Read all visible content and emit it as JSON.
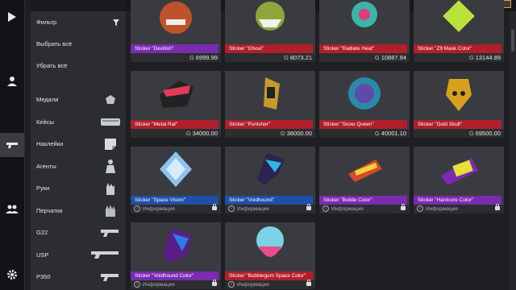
{
  "filter": {
    "title": "Фильтр",
    "select_all": "Выбрать всё",
    "deselect_all": "Убрать всё",
    "categories": [
      {
        "label": "Медали",
        "icon": "medal-icon"
      },
      {
        "label": "Кейсы",
        "icon": "case-icon"
      },
      {
        "label": "Наклейки",
        "icon": "sticker-icon"
      },
      {
        "label": "Агенты",
        "icon": "agent-icon"
      },
      {
        "label": "Руки",
        "icon": "hands-icon"
      },
      {
        "label": "Перчатки",
        "icon": "gloves-icon"
      },
      {
        "label": "G22",
        "icon": "pistol-icon"
      },
      {
        "label": "USP",
        "icon": "pistol-icon"
      },
      {
        "label": "P350",
        "icon": "pistol-icon"
      }
    ]
  },
  "currency_symbol": "G",
  "info_label": "Информация",
  "items": [
    {
      "name": "Sticker \"Devilish\"",
      "price": "6999.99",
      "rarity_color": "#7b2bb0"
    },
    {
      "name": "Sticker \"Ghoul\"",
      "price": "8073.21",
      "rarity_color": "#b01f2a"
    },
    {
      "name": "Sticker \"Radiate Heat\"",
      "price": "10887.94",
      "rarity_color": "#b01f2a"
    },
    {
      "name": "Sticker \"Z9 Mask Color\"",
      "price": "13144.89",
      "rarity_color": "#b01f2a"
    },
    {
      "name": "Sticker \"Metal Rat\"",
      "price": "34000.00",
      "rarity_color": "#b01f2a"
    },
    {
      "name": "Sticker \"Punisher\"",
      "price": "36000.00",
      "rarity_color": "#b01f2a"
    },
    {
      "name": "Sticker \"Snow Queen\"",
      "price": "40001.10",
      "rarity_color": "#b01f2a"
    },
    {
      "name": "Sticker \"Gold Skull\"",
      "price": "69500.00",
      "rarity_color": "#b01f2a"
    },
    {
      "name": "Sticker \"Space Vision\"",
      "price": "",
      "rarity_color": "#1f4fa8"
    },
    {
      "name": "Sticker \"Voidhound\"",
      "price": "",
      "rarity_color": "#1f4fa8"
    },
    {
      "name": "Sticker \"Bolide Color\"",
      "price": "",
      "rarity_color": "#7b2bb0"
    },
    {
      "name": "Sticker \"Hardcore Color\"",
      "price": "",
      "rarity_color": "#7b2bb0"
    },
    {
      "name": "Sticker \"Voidhound Color\"",
      "price": "",
      "rarity_color": "#7b2bb0"
    },
    {
      "name": "Sticker \"Bubblegum Space Color\"",
      "price": "",
      "rarity_color": "#b01f2a"
    }
  ]
}
